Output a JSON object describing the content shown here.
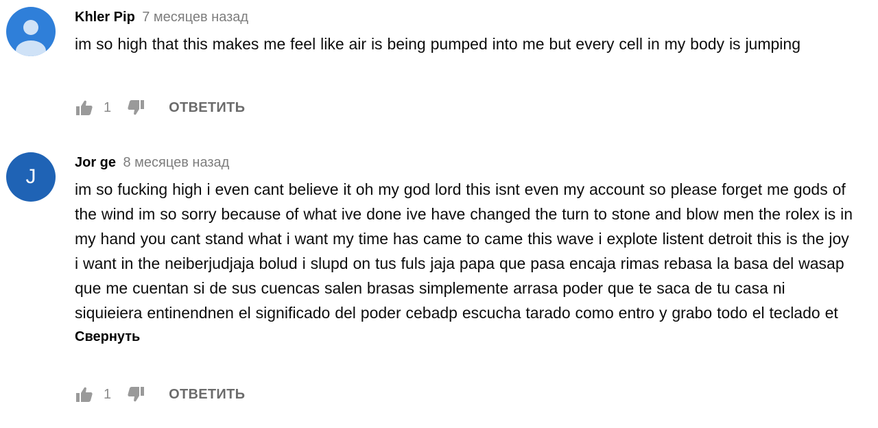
{
  "comments": [
    {
      "author": "Khler Pip",
      "time": "7 месяцев назад",
      "text": "im so high that this makes me feel like air is being pumped into me but every cell in my body is jumping",
      "likes": "1",
      "reply_label": "ОТВЕТИТЬ",
      "avatar": "default-user-icon"
    },
    {
      "author": "Jor ge",
      "time": "8 месяцев назад",
      "avatar_letter": "J",
      "text": "im so fucking high i even cant believe it oh my god lord this isnt even my account so please forget me gods of the wind im so sorry because of what ive done ive have changed the turn to stone and blow men the rolex is in my hand you cant stand what i want my time has came to came this wave i explote listent detroit this is the joy i want in the neiberjudjaja bolud i slupd on tus fuls jaja papa que pasa encaja rimas rebasa la basa del wasap que me cuentan si de sus cuencas salen brasas simplemente arrasa poder que te saca de tu casa ni siquieiera entinendnen el significado del poder cebadp escucha tarado como entro y grabo todo el teclado et",
      "collapse_label": "Свернуть",
      "likes": "1",
      "reply_label": "ОТВЕТИТЬ"
    }
  ],
  "colors": {
    "avatar_default": "#2f7fd9",
    "avatar_letter_bg": "#1f63b5",
    "muted_text": "#7d7d7d",
    "icon_gray": "#9a9a9a"
  }
}
